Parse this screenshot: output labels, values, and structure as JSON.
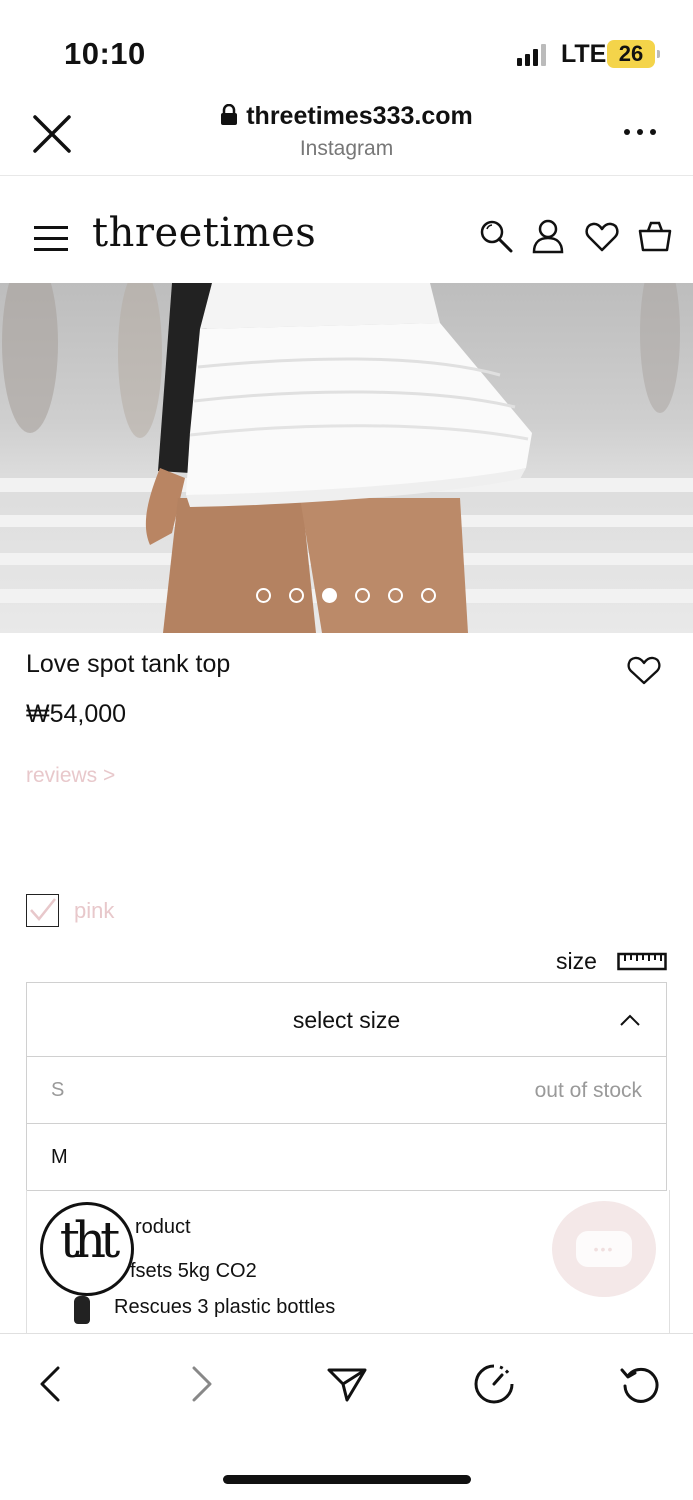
{
  "status_bar": {
    "time": "10:10",
    "network": "LTE",
    "battery": "26"
  },
  "browser": {
    "url": "threetimes333.com",
    "source": "Instagram"
  },
  "site": {
    "logo": "threetimes"
  },
  "carousel": {
    "total": 6,
    "active": 3
  },
  "product": {
    "name": "Love spot tank top",
    "price": "₩54,000",
    "reviews_link": "reviews >",
    "color": "pink",
    "size_label": "size"
  },
  "size_select": {
    "placeholder": "select size",
    "options": [
      {
        "label": "S",
        "status": "out of stock"
      },
      {
        "label": "M",
        "status": ""
      }
    ]
  },
  "eco": {
    "line1": "roduct",
    "line2": "fsets 5kg CO2",
    "line3": "Rescues 3 plastic bottles",
    "badge": "tht"
  },
  "colors": {
    "accent_pink": "#e8c8cb",
    "battery": "#f4d44a"
  }
}
